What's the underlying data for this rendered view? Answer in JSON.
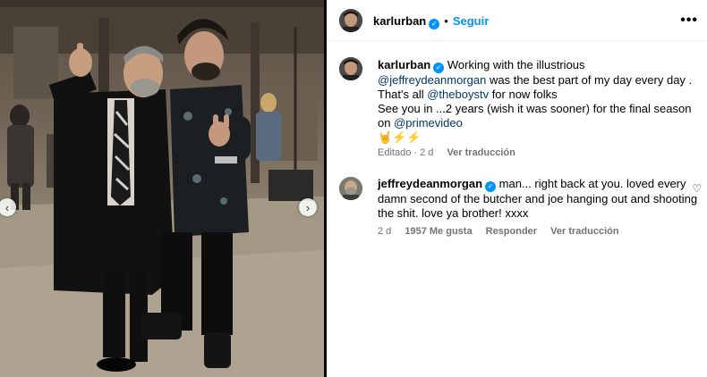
{
  "post": {
    "author": "karlurban",
    "follow_label": "Seguir",
    "separator": "•",
    "more_label": "✕",
    "caption": {
      "author": "karlurban",
      "text_1": "Working with the illustrious",
      "mention_1": "@jeffreydeanmorgan",
      "text_2": " was the best part of my day every day .",
      "text_3": "That's all ",
      "mention_2": "@theboystv",
      "text_4": " for now folks",
      "text_5": "See you in ...2 years (wish it was sooner) for the final season",
      "text_6": "on ",
      "mention_3": "@primevideo",
      "emojis": "🤘⚡⚡"
    },
    "caption_meta": {
      "edited": "Editado · 2 d",
      "translate": "Ver traducción"
    }
  },
  "comment": {
    "author": "jeffreydeanmorgan",
    "text": "man... right back at you. loved every damn second of the butcher and joe hanging out and shooting the shit. love ya brother! xxxx",
    "line_1": "man... right back at you. loved every",
    "line_2": "damn second of the butcher and joe hanging out and shooting",
    "line_3": "the shit. love ya brother! xxxx",
    "time": "2 d",
    "likes": "1957 Me gusta",
    "reply": "Responder",
    "translate": "Ver traducción"
  },
  "icons": {
    "verified": "verified-badge-icon",
    "more": "more-options-icon",
    "heart": "heart-icon",
    "prev": "chevron-left-icon",
    "next": "chevron-right-icon"
  },
  "colors": {
    "accent": "#0095f6",
    "link": "#00376b",
    "muted": "#737373"
  }
}
